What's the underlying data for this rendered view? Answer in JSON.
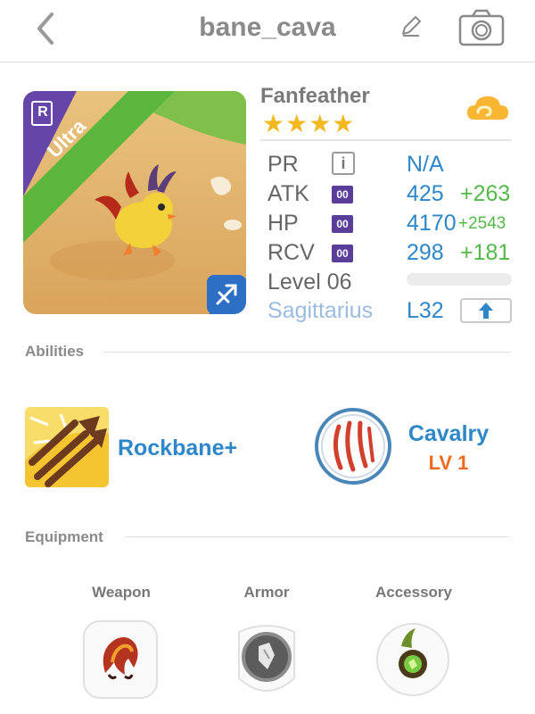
{
  "header": {
    "title": "bane_cava",
    "back_icon": "chevron-left-icon",
    "edit_icon": "pencil-icon",
    "camera_icon": "camera-icon"
  },
  "monster": {
    "rarity": "Ultra",
    "rarity_badge": "R",
    "name": "Fanfeather",
    "stars": "★★★★",
    "star_count": 4,
    "element_icon": "cloud-icon",
    "stats": {
      "pr": {
        "label": "PR",
        "badge": "i",
        "value": "N/A"
      },
      "atk": {
        "label": "ATK",
        "badge": "00",
        "value": "425",
        "bonus": "+263"
      },
      "hp": {
        "label": "HP",
        "badge": "00",
        "value": "4170",
        "bonus": "+2543"
      },
      "rcv": {
        "label": "RCV",
        "badge": "00",
        "value": "298",
        "bonus": "+181"
      }
    },
    "level_label": "Level 06",
    "level_progress": 0,
    "sign": "Sagittarius",
    "level_cap": "L32",
    "upgrade_icon": "arrow-up-icon"
  },
  "abilities": {
    "title": "Abilities",
    "ability_name": "Rockbane+",
    "skill_name": "Cavalry",
    "skill_level": "LV 1"
  },
  "equipment": {
    "title": "Equipment",
    "slots": [
      {
        "label": "Weapon"
      },
      {
        "label": "Armor"
      },
      {
        "label": "Accessory"
      }
    ]
  },
  "colors": {
    "accent_blue": "#2e87c8",
    "bonus_green": "#55b94a",
    "level_orange": "#ee6a1e",
    "star_gold": "#f3b81d",
    "ultra_green": "#5cb53c"
  }
}
